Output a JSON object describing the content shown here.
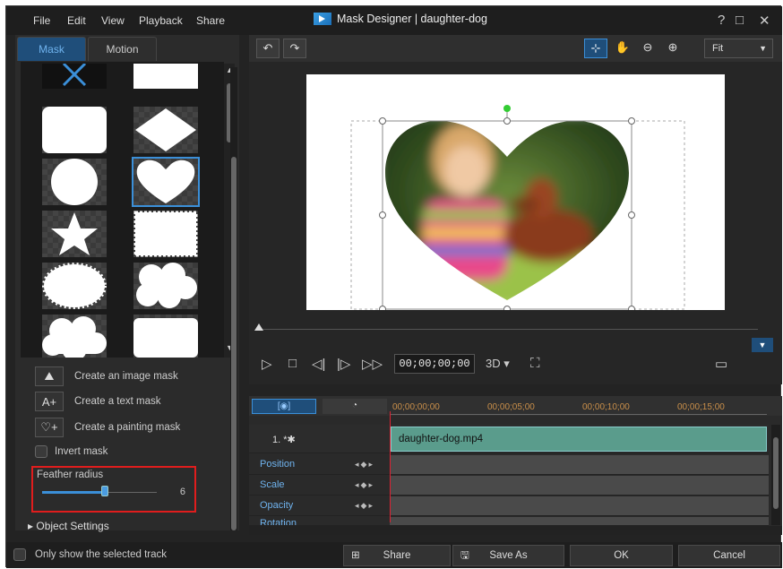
{
  "menu": [
    "File",
    "Edit",
    "View",
    "Playback",
    "Share"
  ],
  "window_title": "Mask Designer | daughter-dog",
  "window_controls": {
    "help": "?",
    "maximize": "□",
    "close": "✕"
  },
  "tabs": {
    "mask": "Mask",
    "motion": "Motion"
  },
  "masks": [
    "x-shape",
    "rectangle",
    "rounded-rectangle",
    "diamond",
    "circle",
    "heart",
    "star",
    "stamp",
    "burst",
    "cloud",
    "cloud-2",
    "rounded-rectangle-2"
  ],
  "actions": {
    "image": "Create an image mask",
    "text": "Create a text mask",
    "painting": "Create a painting mask"
  },
  "invert_mask": "Invert mask",
  "feather": {
    "label": "Feather radius",
    "value": "6",
    "level_percent": 55
  },
  "object_settings": "Object Settings",
  "zoom": "Fit",
  "timecode": "00;00;00;00",
  "mode_3d": "3D",
  "ruler": [
    "00;00;00;00",
    "00;00;05;00",
    "00;00;10;00",
    "00;00;15;00"
  ],
  "track": {
    "number": "1.",
    "clip": "daughter-dog.mp4"
  },
  "attributes": [
    "Position",
    "Scale",
    "Opacity",
    "Rotation"
  ],
  "bottom": {
    "only_selected": "Only show the selected track",
    "share": "Share",
    "save_as": "Save As",
    "ok": "OK",
    "cancel": "Cancel"
  },
  "colors": {
    "accent": "#3b8fd8",
    "highlight": "#e01d1d",
    "clip": "#5a9c8c"
  }
}
